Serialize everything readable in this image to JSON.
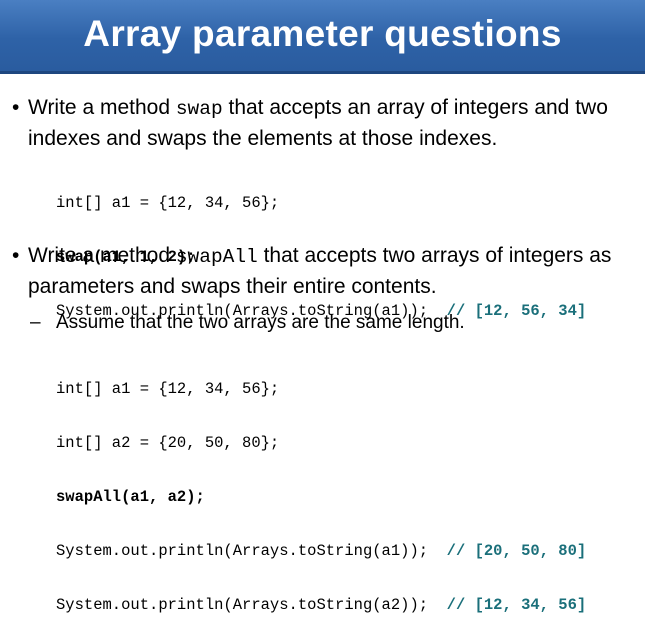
{
  "title": "Array parameter questions",
  "bullet1": {
    "marker": "•",
    "pre": "Write a method ",
    "code": "swap",
    "post": " that accepts an array of integers and two indexes and swaps the elements at those indexes."
  },
  "code1": {
    "line1": "int[] a1 = {12, 34, 56};",
    "line2": "swap(a1, 1, 2);",
    "line3_code": "System.out.println(Arrays.toString(a1));",
    "line3_comment": "// [12, 56, 34]"
  },
  "bullet2": {
    "marker": "•",
    "pre": "Write a method ",
    "code": "swapAll",
    "post": " that accepts two arrays of integers as parameters and swaps their entire contents."
  },
  "sub_bullet": {
    "marker": "–",
    "text": "Assume that the two arrays are the same length."
  },
  "code2": {
    "line1": "int[] a1 = {12, 34, 56};",
    "line2": "int[] a2 = {20, 50, 80};",
    "line3": "swapAll(a1, a2);",
    "line4_code": "System.out.println(Arrays.toString(a1));",
    "line4_comment": "// [20, 50, 80]",
    "line5_code": "System.out.println(Arrays.toString(a2));",
    "line5_comment": "// [12, 34, 56]"
  },
  "colors": {
    "title_bar": "#2e62a7",
    "comment": "#1a6f7a"
  }
}
